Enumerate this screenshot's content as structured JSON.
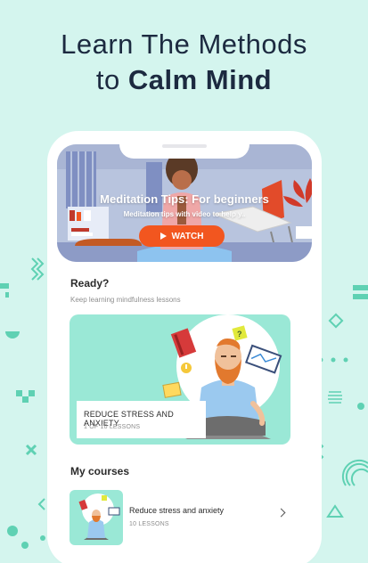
{
  "headline": {
    "line1": "Learn The Methods",
    "line2_prefix": "to ",
    "line2_bold": "Calm Mind"
  },
  "hero": {
    "title": "Meditation Tips: For beginners",
    "subtitle": "Meditation tips with video to help y..",
    "watch_label": "WATCH",
    "watch_color": "#f2561f"
  },
  "ready": {
    "title": "Ready?",
    "subtitle": "Keep learning mindfulness lessons"
  },
  "lesson_card": {
    "title": "REDUCE STRESS AND ANXIETY",
    "progress": "1 OF 10 LESSONS",
    "bg_color": "#9ae8d6"
  },
  "my_courses": {
    "heading": "My courses",
    "items": [
      {
        "title": "Reduce stress and anxiety",
        "lessons": "10 LESSONS"
      }
    ]
  },
  "colors": {
    "page_bg": "#d4f5ee",
    "headline": "#1c2a40",
    "decor": "#5fd1b3"
  }
}
